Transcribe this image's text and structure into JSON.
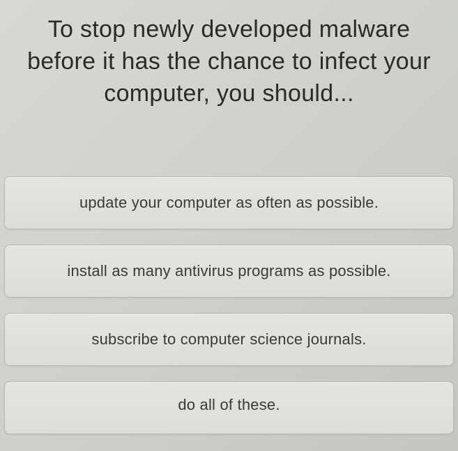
{
  "question": {
    "text": "To stop newly developed malware before it has the chance to infect your computer, you should..."
  },
  "options": [
    {
      "label": "update your computer as often as possible."
    },
    {
      "label": "install as many antivirus programs as possible."
    },
    {
      "label": "subscribe to computer science journals."
    },
    {
      "label": "do all of these."
    }
  ]
}
